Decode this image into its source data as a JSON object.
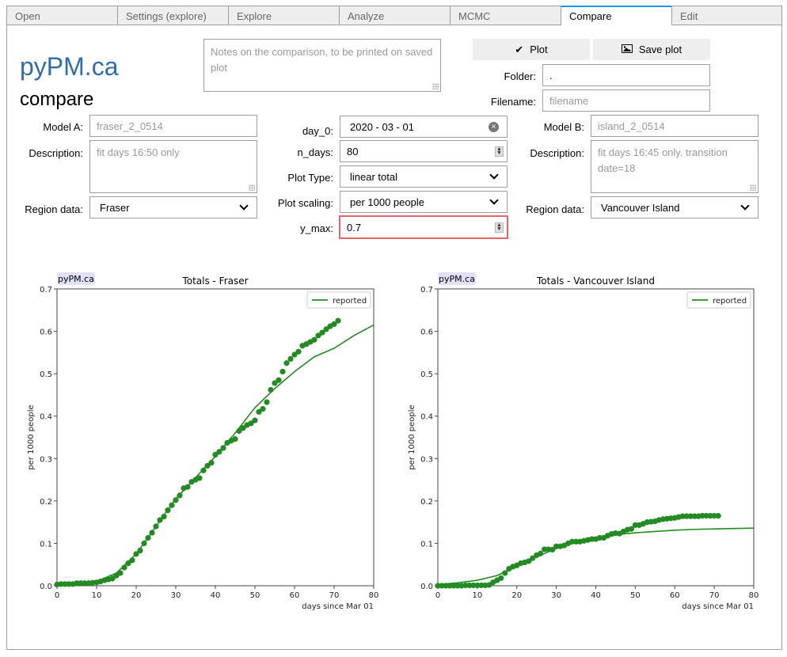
{
  "tabs": [
    {
      "label": "Open",
      "active": false
    },
    {
      "label": "Settings (explore)",
      "active": false
    },
    {
      "label": "Explore",
      "active": false
    },
    {
      "label": "Analyze",
      "active": false
    },
    {
      "label": "MCMC",
      "active": false
    },
    {
      "label": "Compare",
      "active": true
    },
    {
      "label": "Edit",
      "active": false
    }
  ],
  "header": {
    "logo": "pyPM.ca",
    "subtitle": "compare"
  },
  "notes": {
    "placeholder": "Notes on the comparison, to be printed on saved plot"
  },
  "toolbar": {
    "plot_label": "Plot",
    "save_label": "Save plot",
    "plot_icon": "check-icon",
    "save_icon": "image-icon"
  },
  "folder": {
    "label": "Folder:",
    "value": "."
  },
  "filename": {
    "label": "Filename:",
    "placeholder": "filename"
  },
  "model_a": {
    "model_label": "Model A:",
    "model_value": "fraser_2_0514",
    "desc_label": "Description:",
    "desc_value": "fit days 16:50 only",
    "region_label": "Region data:",
    "region_value": "Fraser"
  },
  "model_b": {
    "model_label": "Model B:",
    "model_value": "island_2_0514",
    "desc_label": "Description:",
    "desc_value": "fit days 16:45 only. transition date=18",
    "region_label": "Region data:",
    "region_value": "Vancouver Island"
  },
  "controls": {
    "day0_label": "day_0:",
    "day0_value": "2020 - 03 - 01",
    "ndays_label": "n_days:",
    "ndays_value": "80",
    "plottype_label": "Plot Type:",
    "plottype_value": "linear total",
    "scaling_label": "Plot scaling:",
    "scaling_value": "per 1000 people",
    "ymax_label": "y_max:",
    "ymax_value": "0.7"
  },
  "colors": {
    "series": "#228b22",
    "tab_accent": "#2196f3",
    "error_border": "#e06666",
    "logo": "#2f6fa8",
    "watermark_bg": "#e0e0f8"
  },
  "chart_data": [
    {
      "type": "scatter",
      "title": "Totals - Fraser",
      "watermark": "pyPM.ca",
      "xlabel": "days since Mar 01",
      "ylabel": "per 1000 people",
      "xlim": [
        0,
        80
      ],
      "ylim": [
        0,
        0.7
      ],
      "xticks": [
        "0",
        "10",
        "20",
        "30",
        "40",
        "50",
        "60",
        "70",
        "80"
      ],
      "yticks": [
        "0.0",
        "0.1",
        "0.2",
        "0.3",
        "0.4",
        "0.5",
        "0.6",
        "0.7"
      ],
      "legend": {
        "label": "reported",
        "position": "top-right"
      },
      "grid": false,
      "points": {
        "x_start": 0,
        "values": [
          0.003,
          0.004,
          0.004,
          0.004,
          0.004,
          0.006,
          0.006,
          0.006,
          0.006,
          0.007,
          0.008,
          0.01,
          0.013,
          0.015,
          0.017,
          0.024,
          0.03,
          0.043,
          0.053,
          0.06,
          0.075,
          0.083,
          0.1,
          0.113,
          0.125,
          0.14,
          0.155,
          0.163,
          0.178,
          0.19,
          0.202,
          0.213,
          0.23,
          0.233,
          0.245,
          0.25,
          0.254,
          0.272,
          0.283,
          0.29,
          0.309,
          0.316,
          0.325,
          0.337,
          0.342,
          0.346,
          0.365,
          0.372,
          0.379,
          0.383,
          0.39,
          0.41,
          0.417,
          0.433,
          0.462,
          0.478,
          0.485,
          0.505,
          0.525,
          0.535,
          0.545,
          0.552,
          0.566,
          0.57,
          0.575,
          0.58,
          0.59,
          0.597,
          0.605,
          0.612,
          0.617,
          0.625
        ]
      },
      "model_line": {
        "x": [
          0,
          5,
          10,
          15,
          20,
          25,
          30,
          35,
          40,
          45,
          50,
          55,
          60,
          65,
          70,
          75,
          80
        ],
        "y": [
          0.002,
          0.004,
          0.01,
          0.03,
          0.075,
          0.14,
          0.205,
          0.255,
          0.305,
          0.36,
          0.42,
          0.465,
          0.505,
          0.54,
          0.56,
          0.59,
          0.615
        ]
      }
    },
    {
      "type": "scatter",
      "title": "Totals - Vancouver Island",
      "watermark": "pyPM.ca",
      "xlabel": "days since Mar 01",
      "ylabel": "per 1000 people",
      "xlim": [
        0,
        80
      ],
      "ylim": [
        0,
        0.7
      ],
      "xticks": [
        "0",
        "10",
        "20",
        "30",
        "40",
        "50",
        "60",
        "70",
        "80"
      ],
      "yticks": [
        "0.0",
        "0.1",
        "0.2",
        "0.3",
        "0.4",
        "0.5",
        "0.6",
        "0.7"
      ],
      "legend": {
        "label": "reported",
        "position": "top-right"
      },
      "grid": false,
      "points": {
        "x_start": 0,
        "values": [
          0.0,
          0.0,
          0.0,
          0.0,
          0.0,
          0.0,
          0.0,
          0.001,
          0.001,
          0.001,
          0.001,
          0.001,
          0.001,
          0.002,
          0.008,
          0.013,
          0.018,
          0.03,
          0.04,
          0.045,
          0.048,
          0.053,
          0.055,
          0.058,
          0.065,
          0.072,
          0.076,
          0.086,
          0.086,
          0.085,
          0.093,
          0.093,
          0.095,
          0.1,
          0.104,
          0.104,
          0.104,
          0.106,
          0.108,
          0.11,
          0.11,
          0.113,
          0.113,
          0.118,
          0.122,
          0.124,
          0.123,
          0.128,
          0.132,
          0.134,
          0.143,
          0.143,
          0.146,
          0.15,
          0.151,
          0.152,
          0.155,
          0.157,
          0.158,
          0.159,
          0.16,
          0.162,
          0.164,
          0.164,
          0.164,
          0.164,
          0.164,
          0.165,
          0.165,
          0.165,
          0.165,
          0.165
        ]
      },
      "model_line": {
        "x": [
          0,
          5,
          10,
          15,
          20,
          25,
          30,
          35,
          40,
          45,
          50,
          55,
          60,
          65,
          70,
          75,
          80
        ],
        "y": [
          0.003,
          0.007,
          0.013,
          0.024,
          0.046,
          0.068,
          0.088,
          0.103,
          0.113,
          0.12,
          0.125,
          0.128,
          0.131,
          0.133,
          0.134,
          0.135,
          0.136
        ]
      }
    }
  ]
}
